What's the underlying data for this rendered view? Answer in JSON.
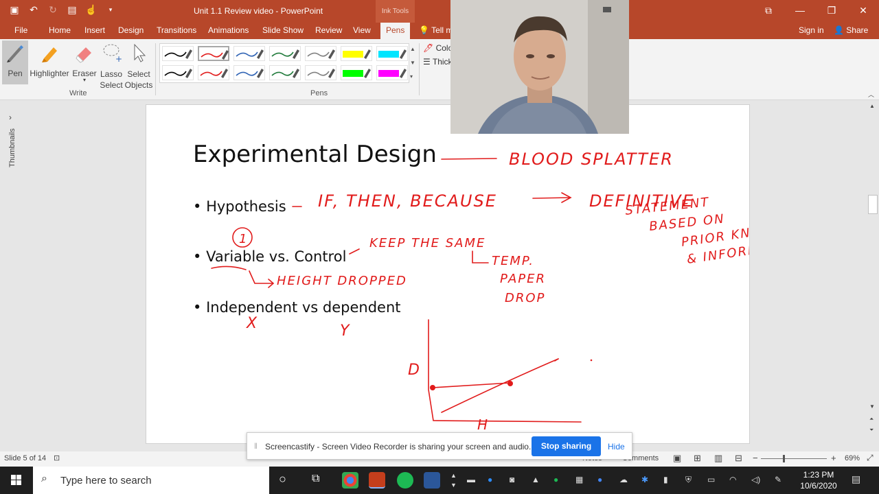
{
  "window": {
    "title": "Unit 1.1 Review video - PowerPoint",
    "context_tab_group": "Ink Tools",
    "accent_color": "#b7472a"
  },
  "ribbon_tabs": [
    "File",
    "Home",
    "Insert",
    "Design",
    "Transitions",
    "Animations",
    "Slide Show",
    "Review",
    "View",
    "Pens",
    "Tell m"
  ],
  "active_tab": "Pens",
  "account": {
    "signin": "Sign in",
    "share": "Share"
  },
  "write_group": {
    "label": "Write",
    "tools": [
      {
        "label": "Pen",
        "icon": "pen-icon",
        "selected": true
      },
      {
        "label": "Highlighter",
        "icon": "highlighter-icon"
      },
      {
        "label": "Eraser",
        "icon": "eraser-icon"
      },
      {
        "label": "Lasso\nSelect",
        "icon": "lasso-icon"
      },
      {
        "label": "Select\nObjects",
        "icon": "cursor-icon"
      }
    ]
  },
  "pens_group": {
    "label": "Pens",
    "pens": [
      {
        "color": "#000000"
      },
      {
        "color": "#e11b1b",
        "selected": true
      },
      {
        "color": "#2f63b4"
      },
      {
        "color": "#1f7a3a"
      },
      {
        "color": "#808080"
      },
      {
        "color": "#ffff00",
        "highlighter": true
      },
      {
        "color": "#00e5ff",
        "highlighter": true
      },
      {
        "color": "#000000"
      },
      {
        "color": "#e11b1b"
      },
      {
        "color": "#2f63b4"
      },
      {
        "color": "#1f7a3a"
      },
      {
        "color": "#808080"
      },
      {
        "color": "#00ff00",
        "highlighter": true
      },
      {
        "color": "#ff00ff",
        "highlighter": true
      }
    ],
    "color_label": "Colo",
    "thickness_label": "Thick"
  },
  "left_rail": {
    "label": "Thumbnails"
  },
  "slide": {
    "title": "Experimental Design",
    "bullets": [
      "Hypothesis",
      "Variable vs. Control",
      "Independent vs dependent"
    ],
    "bullet_char": "•",
    "ink_notes": {
      "title_note": "BLOOD SPLATTER",
      "hypothesis_note": "IF, THEN, BECAUSE",
      "definitive": [
        "DEFINITIVE",
        "STATEMENT",
        "BASED ON",
        "PRIOR KNOWLEDGE",
        "& INFORMATION"
      ],
      "circled_one": "1",
      "keep_same": "KEEP THE SAME",
      "height_dropped": "HEIGHT DROPPED",
      "constants": [
        "TEMP.",
        "PAPER",
        "DROP"
      ],
      "x_label": "X",
      "y_label": "Y",
      "graph_y": "D",
      "graph_x": "H"
    },
    "ink_color": "#e11b1b"
  },
  "status": {
    "slide_count": "Slide 5 of 14",
    "notes": "Notes",
    "comments": "Comments",
    "zoom": "69%"
  },
  "share_banner": {
    "message": "Screencastify - Screen Video Recorder is sharing your screen and audio.",
    "stop_label": "Stop sharing",
    "hide_label": "Hide"
  },
  "taskbar": {
    "search_placeholder": "Type here to search",
    "time": "1:23 PM",
    "date": "10/6/2020"
  }
}
